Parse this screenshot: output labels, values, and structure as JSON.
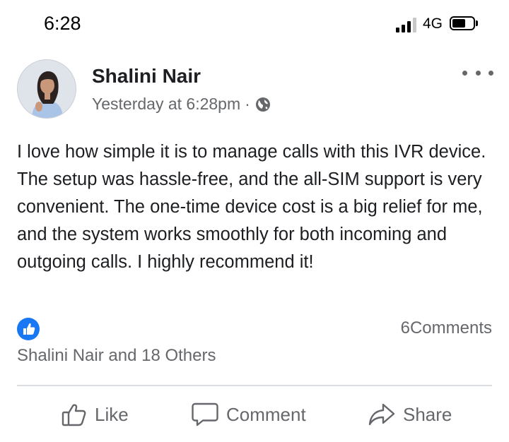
{
  "status_bar": {
    "time": "6:28",
    "network": "4G",
    "signal_bars": 3,
    "signal_total": 4,
    "battery_level": 0.6
  },
  "post": {
    "author": "Shalini Nair",
    "timestamp": "Yesterday at 6:28pm",
    "separator": "·",
    "privacy_icon": "globe-icon",
    "body": "I love how simple it is to manage calls with this IVR device. The setup was hassle-free, and the all-SIM support is very convenient. The one-time device cost is a big relief for me, and the system works smoothly for both incoming and outgoing calls. I highly recommend it!",
    "reaction_icon": "like-reaction-icon",
    "reactions_text": "Shalini Nair and 18 Others",
    "comments_text": "6Comments"
  },
  "actions": {
    "like_label": "Like",
    "comment_label": "Comment",
    "share_label": "Share"
  },
  "colors": {
    "accent": "#1877f2",
    "secondary_text": "#65676b",
    "primary_text": "#1c1e21",
    "divider": "#dadde1"
  }
}
